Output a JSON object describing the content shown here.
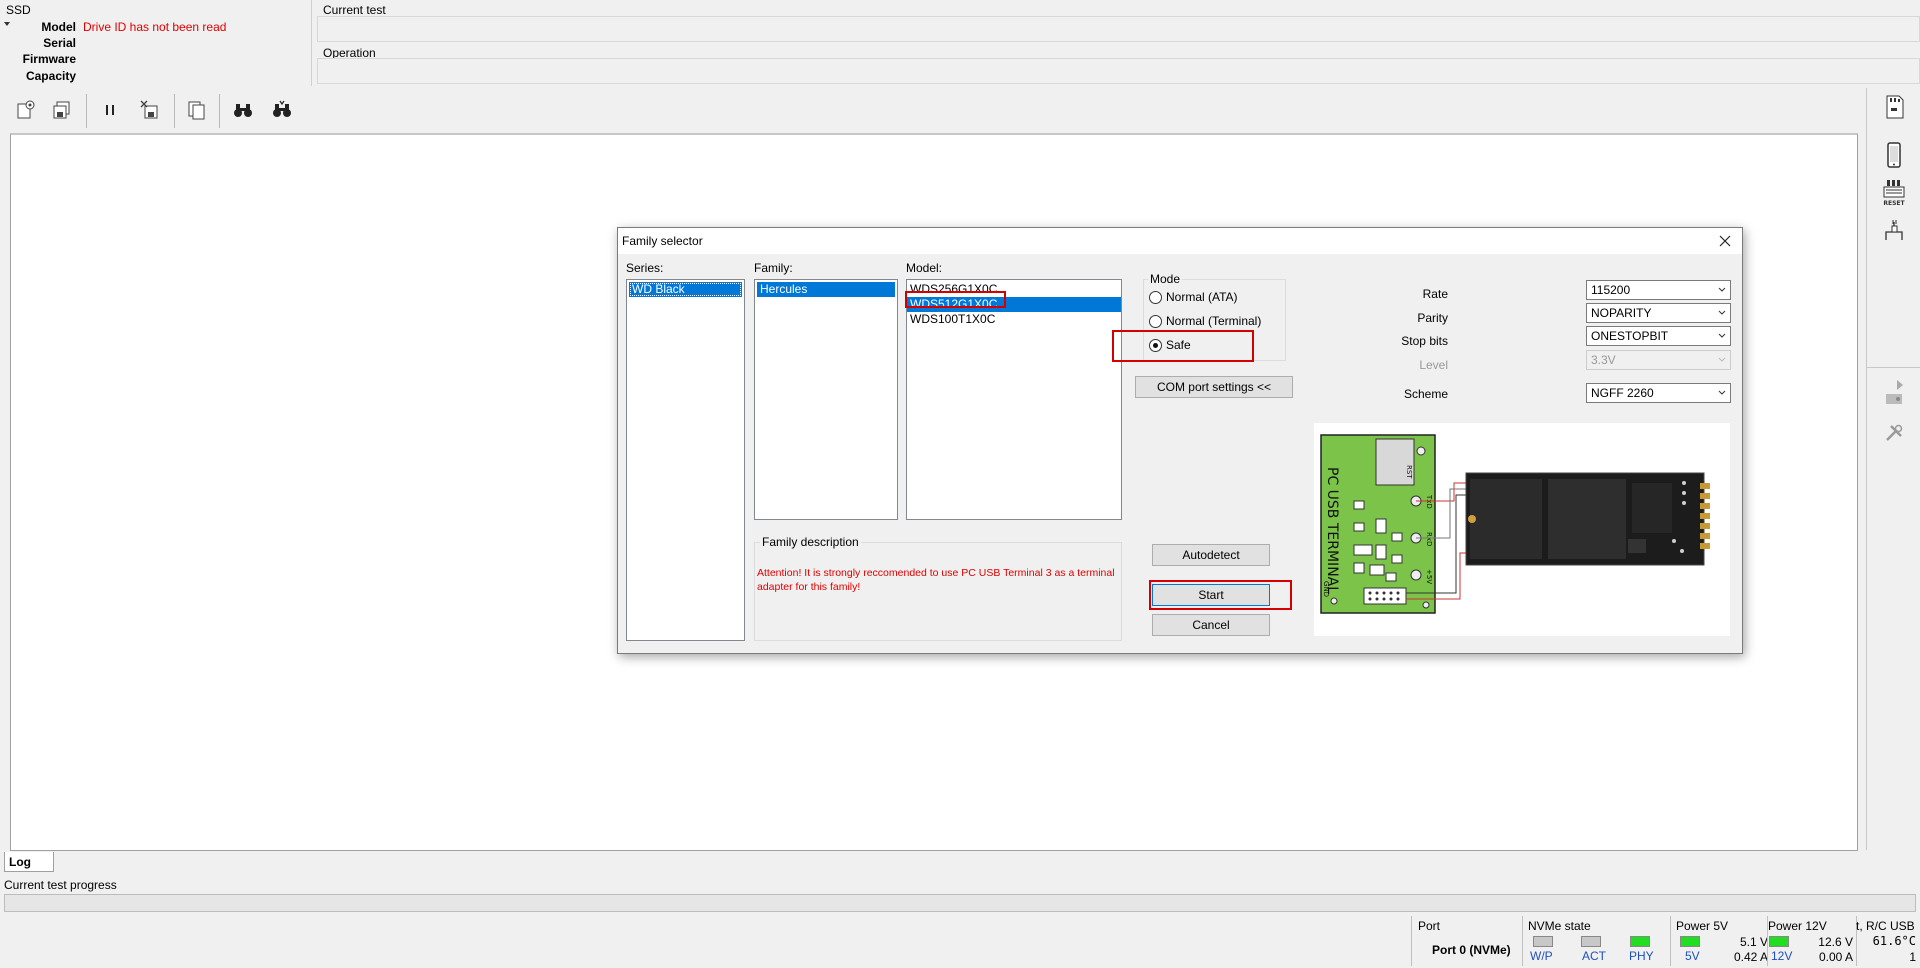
{
  "top": {
    "ssd_panel": {
      "title": "SSD",
      "rows": [
        {
          "label": "Model",
          "value": "Drive ID has not been read"
        },
        {
          "label": "Serial",
          "value": ""
        },
        {
          "label": "Firmware",
          "value": ""
        },
        {
          "label": "Capacity",
          "value": ""
        }
      ]
    },
    "current_test_label": "Current test",
    "operation_label": "Operation"
  },
  "log": {
    "tab_label": "Log",
    "progress_label": "Current test progress"
  },
  "status": {
    "port_title": "Port",
    "port_value": "Port 0 (NVMe)",
    "nvme_title": "NVMe state",
    "nvme_leds": [
      {
        "label": "W/P",
        "color": "#c8c8c8"
      },
      {
        "label": "ACT",
        "color": "#c8c8c8"
      },
      {
        "label": "PHY",
        "color": "#22dd22"
      }
    ],
    "power5_title": "Power 5V",
    "power5_led_label": "5V",
    "power5_voltage": "5.1 V",
    "power5_current": "0.42 A",
    "power12_title": "Power 12V",
    "power12_led_label": "12V",
    "power12_voltage": "12.6 V",
    "power12_current": "0.00 A",
    "temp_title": "t, R/C USB",
    "temp_value": "61.6°C",
    "temp_sub": "1",
    "led_on_color": "#22dd22"
  },
  "dialog": {
    "title": "Family selector",
    "series_label": "Series:",
    "series": [
      "WD Black"
    ],
    "family_label": "Family:",
    "families": [
      "Hercules"
    ],
    "model_label": "Model:",
    "models": [
      "WDS256G1X0C",
      "WDS512G1X0C",
      "WDS100T1X0C"
    ],
    "selected_model_index": 1,
    "mode_title": "Mode",
    "modes": [
      {
        "label": "Normal (ATA)",
        "checked": false
      },
      {
        "label": "Normal (Terminal)",
        "checked": false
      },
      {
        "label": "Safe",
        "checked": true
      }
    ],
    "com_button": "COM port settings <<",
    "family_desc_title": "Family description",
    "family_desc_text": "Attention! It is strongly reccomended to use PC USB Terminal 3 as a terminal adapter for this family!",
    "autodetect_button": "Autodetect",
    "start_button": "Start",
    "cancel_button": "Cancel",
    "settings": {
      "rate_label": "Rate",
      "rate_value": "115200",
      "parity_label": "Parity",
      "parity_value": "NOPARITY",
      "stopbits_label": "Stop bits",
      "stopbits_value": "ONESTOPBIT",
      "level_label": "Level",
      "level_value": "3.3V",
      "scheme_label": "Scheme",
      "scheme_value": "NGFF 2260"
    },
    "diagram": {
      "board_text": "PC USB TERMINAL",
      "pin_labels": [
        "RST",
        "TxD",
        "RxD",
        "+5V",
        "GND"
      ]
    },
    "accent_color": "#0078d7",
    "highlight_color": "#d40000"
  }
}
